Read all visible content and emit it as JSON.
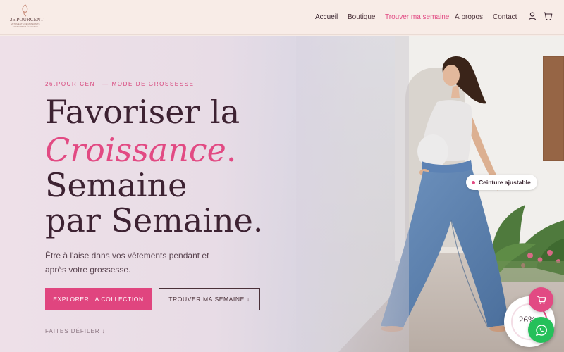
{
  "brand": {
    "name": "26.POURCENT",
    "tagline": "VÊTEMENTS DE MATERNITÉ",
    "tagline2": "CONFORT ET ÉLÉGANCE"
  },
  "nav": {
    "items": [
      "Accueil",
      "Boutique",
      "Trouver ma semaine",
      "À propos",
      "Contact"
    ],
    "active": "Accueil",
    "highlight": "Trouver ma semaine"
  },
  "header_icons": [
    "user-icon",
    "cart-icon"
  ],
  "hero": {
    "eyebrow": "26.POUR CENT — MODE DE GROSSESSE",
    "title_line1": "Favoriser la",
    "title_accent": "Croissance",
    "title_accent_punct": ".",
    "title_line3": "Semaine",
    "title_line4": "par Semaine.",
    "subtitle": "Être à l'aise dans vos vêtements pendant et après votre grossesse.",
    "primary_cta": "EXPLORER LA COLLECTION",
    "secondary_cta": "TROUVER MA SEMAINE ↓",
    "scroll_hint": "FAITES DÉFILER ↓",
    "hotspot_label": "Ceinture ajustable"
  },
  "widgets": {
    "progress_badge": "26%",
    "cart_icon": "shopping-cart-icon",
    "whatsapp_icon": "whatsapp-icon"
  },
  "colors": {
    "accent": "#e24a83",
    "heading": "#3d2232",
    "header_bg": "#f8ece7",
    "whatsapp": "#25c05a"
  }
}
